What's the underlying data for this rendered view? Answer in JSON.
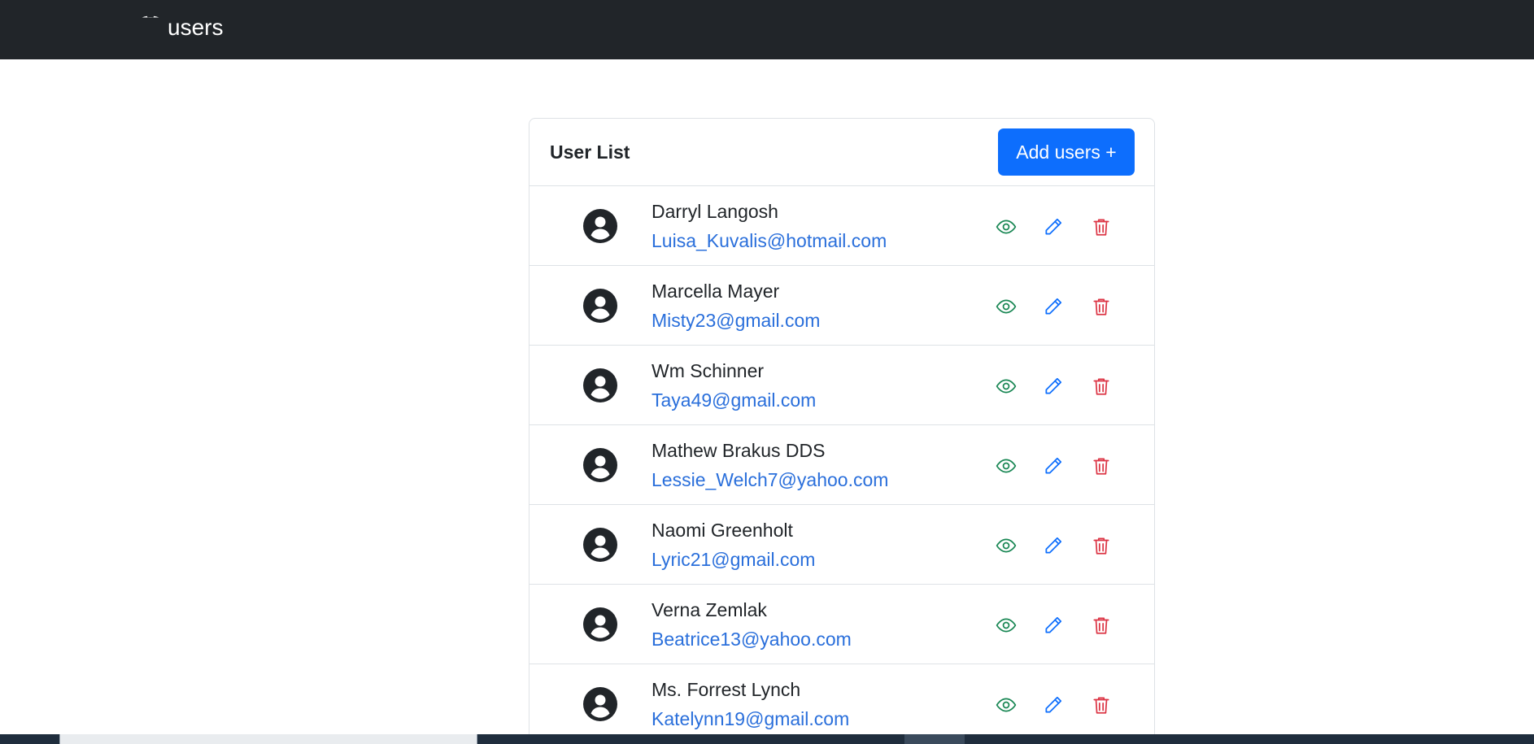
{
  "navbar": {
    "brand_icon": "discord-icon",
    "brand_label": "users"
  },
  "card": {
    "title": "User List",
    "add_button_label": "Add users +"
  },
  "users": [
    {
      "name": "Darryl Langosh",
      "email": "Luisa_Kuvalis@hotmail.com"
    },
    {
      "name": "Marcella Mayer",
      "email": "Misty23@gmail.com"
    },
    {
      "name": "Wm Schinner",
      "email": "Taya49@gmail.com"
    },
    {
      "name": "Mathew Brakus DDS",
      "email": "Lessie_Welch7@yahoo.com"
    },
    {
      "name": "Naomi Greenholt",
      "email": "Lyric21@gmail.com"
    },
    {
      "name": "Verna Zemlak",
      "email": "Beatrice13@yahoo.com"
    },
    {
      "name": "Ms. Forrest Lynch",
      "email": "Katelynn19@gmail.com"
    }
  ],
  "row_icons": {
    "avatar": "user-circle-icon",
    "view": "eye-icon",
    "edit": "pencil-icon",
    "delete": "trash-icon"
  },
  "colors": {
    "navbar": "#212529",
    "primary": "#0d6efd",
    "link": "#2a6fdb",
    "view": "#198754",
    "edit": "#0d6efd",
    "delete": "#dc3545"
  }
}
